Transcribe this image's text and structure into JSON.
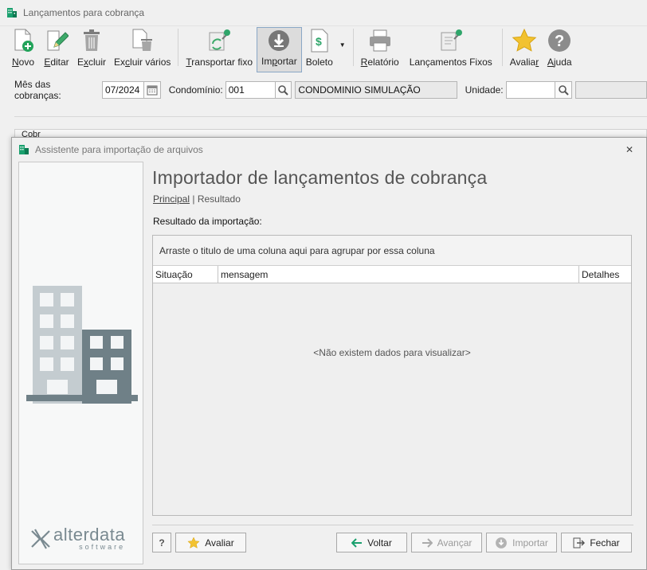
{
  "window": {
    "title": "Lançamentos para cobrança"
  },
  "toolbar": {
    "items": [
      {
        "label": "Novo",
        "u": "N",
        "rest": "ovo"
      },
      {
        "label": "Editar",
        "u": "E",
        "rest": "ditar"
      },
      {
        "label": "Excluir",
        "u": "x",
        "pre": "E",
        "rest": "cluir"
      },
      {
        "label": "Excluir vários",
        "u": "c",
        "pre": "Ex",
        "rest": "luir vários"
      },
      {
        "label": "Transportar fixo",
        "u": "T",
        "rest": "ransportar fixo"
      },
      {
        "label": "Importar",
        "u": "p",
        "pre": "Im",
        "rest": "ortar"
      },
      {
        "label": "Boleto"
      },
      {
        "label": "Relatório",
        "u": "R",
        "rest": "elatório"
      },
      {
        "label": "Lançamentos Fixos"
      },
      {
        "label": "Avaliar",
        "pre": "Avalia",
        "u": "r",
        "rest": ""
      },
      {
        "label": "Ajuda",
        "u": "A",
        "rest": "juda"
      }
    ]
  },
  "filters": {
    "month_label": "Mês das cobranças:",
    "month_value": "07/2024",
    "condo_label": "Condomínio:",
    "condo_code": "001",
    "condo_name": "CONDOMINIO SIMULAÇÃO",
    "unit_label": "Unidade:",
    "unit_value": ""
  },
  "behind": {
    "text": "Cobr"
  },
  "dialog": {
    "title": "Assistente para importação de arquivos",
    "heading": "Importador de lançamentos de cobrança",
    "crumb_link": "Principal",
    "crumb_sep": "|",
    "crumb_current": "Resultado",
    "result_label": "Resultado da importação:",
    "grid": {
      "group_hint": "Arraste o titulo de uma coluna aqui para agrupar por essa coluna",
      "columns": [
        "Situação",
        "mensagem",
        "Detalhes"
      ],
      "empty_text": "<Não existem dados para visualizar>"
    },
    "brand": {
      "name": "alterdata",
      "sub": "software"
    },
    "buttons": {
      "help": "?",
      "rate": "Avaliar",
      "back": "Voltar",
      "next": "Avançar",
      "import": "Importar",
      "close": "Fechar"
    }
  },
  "colors": {
    "accent_green": "#1aa06e",
    "building_light": "#c4ccd0",
    "building_dark": "#6f8087",
    "star": "#f2c230"
  }
}
